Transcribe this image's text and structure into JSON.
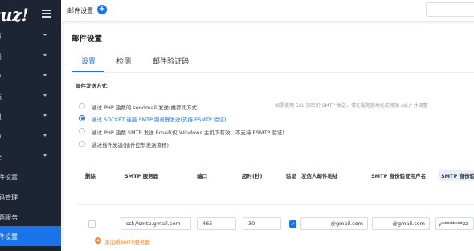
{
  "sidebar": {
    "logo": "cuz!",
    "items": [
      {
        "label": "页"
      },
      {
        "label": "局"
      },
      {
        "label": "户"
      },
      {
        "label": "坛"
      },
      {
        "label": "组"
      },
      {
        "label": "户"
      },
      {
        "label": "全"
      }
    ],
    "sub_items": [
      {
        "label": "件设置"
      },
      {
        "label": "码管理"
      },
      {
        "label": "题服务"
      },
      {
        "label": "件设置"
      }
    ]
  },
  "header": {
    "breadcrumb": "邮件设置"
  },
  "main": {
    "title": "邮件设置",
    "tabs": [
      {
        "label": "设置"
      },
      {
        "label": "检测"
      },
      {
        "label": "邮件验证码"
      }
    ],
    "section_label": "邮件发送方式:",
    "send_methods": [
      {
        "label": "通过 PHP 函数的 sendmail 发送(推荐此方式)",
        "checked": false
      },
      {
        "label": "通过 SOCKET 连接 SMTP 服务器发送(支持 ESMTP 验证)",
        "checked": true
      },
      {
        "label": "通过 PHP 函数 SMTP 发送 Email(仅 Windows 主机下有效，不支持 ESMTP 验证)",
        "checked": false
      },
      {
        "label": "通过插件发送(插件控制发送流程)",
        "checked": false
      }
    ],
    "hint": "如需使用 SSL 加密的 SMTP 发送，请在服务器地址前添加 ssl:// 并调整",
    "table": {
      "headers": {
        "delete": "删除",
        "smtp_server": "SMTP 服务器",
        "port": "端口",
        "timeout": "超时(秒)",
        "auth": "验证",
        "from": "发信人邮件地址",
        "user": "SMTP 身份验证用户名",
        "password": "SMTP 身份验"
      },
      "row": {
        "server": "ssl://smtp.gmail.com",
        "port": "465",
        "timeout": "30",
        "auth_checked": true,
        "from": "@gmail.com",
        "user": "@gmail.com",
        "password": "y********zz"
      }
    },
    "add_server_label": "添加新SMTP服务器"
  },
  "colors": {
    "accent": "#1a73e8",
    "sidebar_bg": "#1d2433",
    "add_orange": "#f5812e"
  }
}
